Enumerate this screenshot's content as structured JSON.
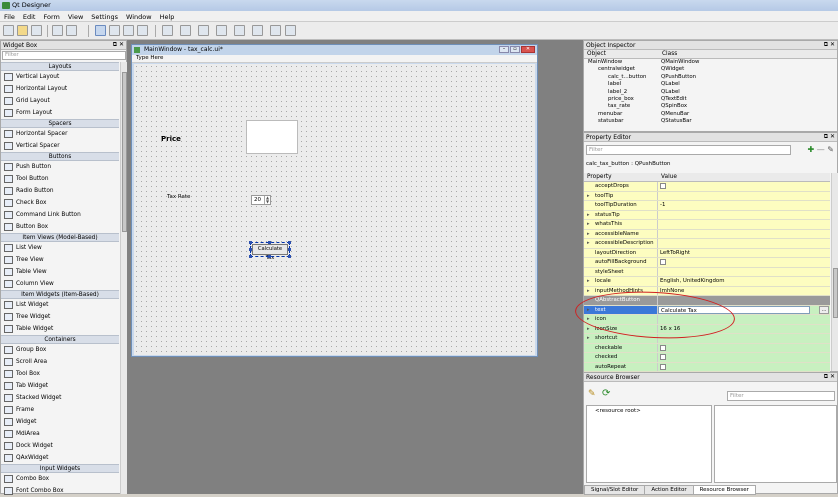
{
  "app": {
    "title": "Qt Designer"
  },
  "menu": [
    "File",
    "Edit",
    "Form",
    "View",
    "Settings",
    "Window",
    "Help"
  ],
  "widget_box": {
    "title": "Widget Box",
    "filter_placeholder": "Filter",
    "sections": [
      {
        "name": "Layouts",
        "items": [
          "Vertical Layout",
          "Horizontal Layout",
          "Grid Layout",
          "Form Layout"
        ]
      },
      {
        "name": "Spacers",
        "items": [
          "Horizontal Spacer",
          "Vertical Spacer"
        ]
      },
      {
        "name": "Buttons",
        "items": [
          "Push Button",
          "Tool Button",
          "Radio Button",
          "Check Box",
          "Command Link Button",
          "Button Box"
        ]
      },
      {
        "name": "Item Views (Model-Based)",
        "items": [
          "List View",
          "Tree View",
          "Table View",
          "Column View"
        ]
      },
      {
        "name": "Item Widgets (Item-Based)",
        "items": [
          "List Widget",
          "Tree Widget",
          "Table Widget"
        ]
      },
      {
        "name": "Containers",
        "items": [
          "Group Box",
          "Scroll Area",
          "Tool Box",
          "Tab Widget",
          "Stacked Widget",
          "Frame",
          "Widget",
          "MdiArea",
          "Dock Widget",
          "QAxWidget"
        ]
      },
      {
        "name": "Input Widgets",
        "items": [
          "Combo Box",
          "Font Combo Box"
        ]
      }
    ]
  },
  "form_window": {
    "title": "MainWindow - tax_calc.ui*",
    "menu_placeholder": "Type Here",
    "price_label": "Price",
    "tax_label": "Tax Rate",
    "tax_value": "20",
    "button_label": "Calculate Tax"
  },
  "object_inspector": {
    "title": "Object Inspector",
    "col_object": "Object",
    "col_class": "Class",
    "rows": [
      {
        "object": "MainWindow",
        "class": "QMainWindow",
        "indent": 0
      },
      {
        "object": "centralwidget",
        "class": "QWidget",
        "indent": 1
      },
      {
        "object": "calc_t...button",
        "class": "QPushButton",
        "indent": 2
      },
      {
        "object": "label",
        "class": "QLabel",
        "indent": 2
      },
      {
        "object": "label_2",
        "class": "QLabel",
        "indent": 2
      },
      {
        "object": "price_box",
        "class": "QTextEdit",
        "indent": 2
      },
      {
        "object": "tax_rate",
        "class": "QSpinBox",
        "indent": 2
      },
      {
        "object": "menubar",
        "class": "QMenuBar",
        "indent": 1
      },
      {
        "object": "statusbar",
        "class": "QStatusBar",
        "indent": 1
      }
    ]
  },
  "property_editor": {
    "title": "Property Editor",
    "filter_placeholder": "Filter",
    "object_line": "calc_tax_button : QPushButton",
    "col_property": "Property",
    "col_value": "Value",
    "rows": [
      {
        "k": "acceptDrops",
        "v": "",
        "type": "check",
        "style": "y"
      },
      {
        "k": "toolTip",
        "v": "",
        "style": "y",
        "arrow": true
      },
      {
        "k": "toolTipDuration",
        "v": "-1",
        "style": "y"
      },
      {
        "k": "statusTip",
        "v": "",
        "style": "y",
        "arrow": true
      },
      {
        "k": "whatsThis",
        "v": "",
        "style": "y",
        "arrow": true
      },
      {
        "k": "accessibleName",
        "v": "",
        "style": "y",
        "arrow": true
      },
      {
        "k": "accessibleDescription",
        "v": "",
        "style": "y",
        "arrow": true
      },
      {
        "k": "layoutDirection",
        "v": "LeftToRight",
        "style": "y"
      },
      {
        "k": "autoFillBackground",
        "v": "",
        "type": "check",
        "style": "y"
      },
      {
        "k": "styleSheet",
        "v": "",
        "style": "y"
      },
      {
        "k": "locale",
        "v": "English, UnitedKingdom",
        "style": "y",
        "arrow": true
      },
      {
        "k": "inputMethodHints",
        "v": "ImhNone",
        "style": "y",
        "arrow": true
      },
      {
        "k": "QAbstractButton",
        "v": "",
        "style": "grp"
      },
      {
        "k": "text",
        "v": "Calculate Tax",
        "style": "g",
        "arrow": true,
        "selected": true,
        "editing": true
      },
      {
        "k": "icon",
        "v": "",
        "style": "g",
        "arrow": true
      },
      {
        "k": "iconSize",
        "v": "16 x 16",
        "style": "g",
        "arrow": true
      },
      {
        "k": "shortcut",
        "v": "",
        "style": "g",
        "arrow": true
      },
      {
        "k": "checkable",
        "v": "",
        "type": "check",
        "style": "g"
      },
      {
        "k": "checked",
        "v": "",
        "type": "check",
        "style": "g"
      },
      {
        "k": "autoRepeat",
        "v": "",
        "type": "check",
        "style": "g"
      }
    ]
  },
  "resource_browser": {
    "title": "Resource Browser",
    "filter_placeholder": "Filter",
    "root": "<resource root>",
    "tabs": [
      "Signal/Slot Editor",
      "Action Editor",
      "Resource Browser"
    ],
    "active_tab": 2
  }
}
